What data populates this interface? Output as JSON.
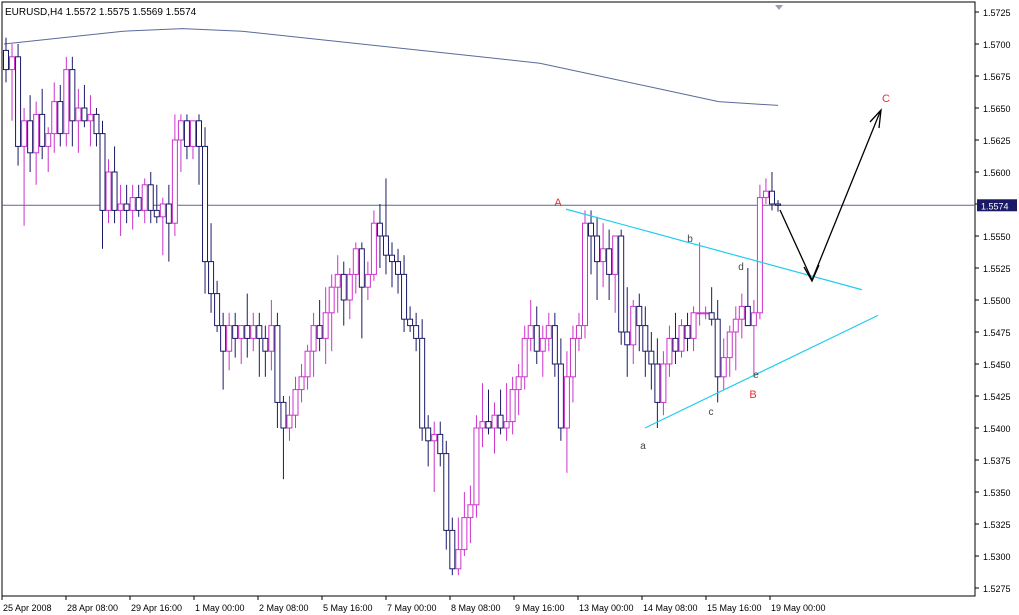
{
  "header": {
    "symbol_line": "EURUSD,H4  1.5572 1.5575 1.5569 1.5574"
  },
  "colors": {
    "background": "#ffffff",
    "bull": "#cc33cc",
    "bear": "#1a1a66",
    "moving_average": "#5a6a9a",
    "triangle": "#22ccee",
    "wave_labels_red": "#e83030",
    "wave_labels_gray": "#444444",
    "arrows": "#000000",
    "price_line": "#5a6a8a",
    "price_box": "#1a1a66"
  },
  "chart_data": {
    "type": "candlestick",
    "title": "EURUSD,H4",
    "header_values": {
      "open": 1.5572,
      "high": 1.5575,
      "low": 1.5569,
      "close": 1.5574
    },
    "x_tick_labels": [
      "25 Apr 2008",
      "28 Apr 08:00",
      "29 Apr 16:00",
      "1 May 00:00",
      "2 May 08:00",
      "5 May 16:00",
      "7 May 00:00",
      "8 May 08:00",
      "9 May 16:00",
      "13 May 00:00",
      "14 May 08:00",
      "15 May 16:00",
      "19 May 00:00"
    ],
    "y_tick_labels": [
      "1.5725",
      "1.5700",
      "1.5675",
      "1.5650",
      "1.5625",
      "1.5600",
      "1.5575",
      "1.5550",
      "1.5525",
      "1.5500",
      "1.5475",
      "1.5450",
      "1.5425",
      "1.5400",
      "1.5375",
      "1.5350",
      "1.5325",
      "1.5300",
      "1.5275"
    ],
    "ylim": [
      1.5268,
      1.5729
    ],
    "current_price": "1.5574",
    "candles": [
      [
        1.5695,
        1.5705,
        1.567,
        1.568
      ],
      [
        1.568,
        1.57,
        1.564,
        1.569
      ],
      [
        1.569,
        1.57,
        1.5605,
        1.562
      ],
      [
        1.562,
        1.565,
        1.5558,
        1.564
      ],
      [
        1.564,
        1.566,
        1.56,
        1.5615
      ],
      [
        1.5615,
        1.5655,
        1.559,
        1.5645
      ],
      [
        1.5645,
        1.5665,
        1.561,
        1.562
      ],
      [
        1.562,
        1.5635,
        1.56,
        1.563
      ],
      [
        1.563,
        1.567,
        1.5615,
        1.5655
      ],
      [
        1.5655,
        1.5668,
        1.562,
        1.563
      ],
      [
        1.563,
        1.569,
        1.562,
        1.568
      ],
      [
        1.568,
        1.569,
        1.562,
        1.564
      ],
      [
        1.564,
        1.5665,
        1.5615,
        1.565
      ],
      [
        1.565,
        1.5668,
        1.5635,
        1.564
      ],
      [
        1.564,
        1.566,
        1.562,
        1.5645
      ],
      [
        1.5645,
        1.565,
        1.562,
        1.563
      ],
      [
        1.563,
        1.564,
        1.554,
        1.557
      ],
      [
        1.557,
        1.561,
        1.556,
        1.56
      ],
      [
        1.56,
        1.562,
        1.556,
        1.557
      ],
      [
        1.557,
        1.559,
        1.555,
        1.5575
      ],
      [
        1.5575,
        1.559,
        1.556,
        1.557
      ],
      [
        1.557,
        1.559,
        1.5555,
        1.558
      ],
      [
        1.558,
        1.559,
        1.5565,
        1.557
      ],
      [
        1.557,
        1.5595,
        1.556,
        1.559
      ],
      [
        1.559,
        1.56,
        1.556,
        1.557
      ],
      [
        1.557,
        1.559,
        1.556,
        1.5565
      ],
      [
        1.5565,
        1.558,
        1.5535,
        1.5575
      ],
      [
        1.5575,
        1.559,
        1.553,
        1.556
      ],
      [
        1.556,
        1.5645,
        1.555,
        1.5625
      ],
      [
        1.5625,
        1.5645,
        1.56,
        1.564
      ],
      [
        1.564,
        1.5645,
        1.561,
        1.562
      ],
      [
        1.562,
        1.564,
        1.561,
        1.564
      ],
      [
        1.564,
        1.5645,
        1.559,
        1.562
      ],
      [
        1.562,
        1.5635,
        1.5505,
        1.553
      ],
      [
        1.553,
        1.556,
        1.549,
        1.5505
      ],
      [
        1.5505,
        1.5515,
        1.5475,
        1.548
      ],
      [
        1.548,
        1.549,
        1.543,
        1.546
      ],
      [
        1.546,
        1.549,
        1.5445,
        1.548
      ],
      [
        1.548,
        1.549,
        1.5455,
        1.547
      ],
      [
        1.547,
        1.548,
        1.545,
        1.548
      ],
      [
        1.548,
        1.5505,
        1.5455,
        1.547
      ],
      [
        1.547,
        1.549,
        1.546,
        1.548
      ],
      [
        1.548,
        1.549,
        1.544,
        1.547
      ],
      [
        1.547,
        1.548,
        1.544,
        1.546
      ],
      [
        1.546,
        1.55,
        1.5445,
        1.548
      ],
      [
        1.548,
        1.549,
        1.54,
        1.542
      ],
      [
        1.542,
        1.5425,
        1.536,
        1.54
      ],
      [
        1.54,
        1.5425,
        1.539,
        1.541
      ],
      [
        1.541,
        1.544,
        1.54,
        1.543
      ],
      [
        1.543,
        1.545,
        1.542,
        1.544
      ],
      [
        1.544,
        1.5465,
        1.543,
        1.546
      ],
      [
        1.546,
        1.549,
        1.544,
        1.548
      ],
      [
        1.548,
        1.55,
        1.546,
        1.547
      ],
      [
        1.547,
        1.551,
        1.545,
        1.549
      ],
      [
        1.549,
        1.552,
        1.546,
        1.551
      ],
      [
        1.551,
        1.5535,
        1.549,
        1.552
      ],
      [
        1.552,
        1.553,
        1.548,
        1.55
      ],
      [
        1.55,
        1.5525,
        1.5485,
        1.552
      ],
      [
        1.552,
        1.5545,
        1.5505,
        1.554
      ],
      [
        1.554,
        1.5545,
        1.547,
        1.551
      ],
      [
        1.551,
        1.553,
        1.55,
        1.552
      ],
      [
        1.552,
        1.557,
        1.5515,
        1.556
      ],
      [
        1.556,
        1.5575,
        1.5525,
        1.555
      ],
      [
        1.555,
        1.5595,
        1.552,
        1.5535
      ],
      [
        1.5535,
        1.5545,
        1.551,
        1.553
      ],
      [
        1.553,
        1.554,
        1.5505,
        1.552
      ],
      [
        1.552,
        1.5535,
        1.5475,
        1.5485
      ],
      [
        1.5485,
        1.5495,
        1.5475,
        1.548
      ],
      [
        1.548,
        1.549,
        1.546,
        1.547
      ],
      [
        1.547,
        1.5485,
        1.539,
        1.54
      ],
      [
        1.54,
        1.541,
        1.537,
        1.539
      ],
      [
        1.539,
        1.5405,
        1.535,
        1.5395
      ],
      [
        1.5395,
        1.5405,
        1.537,
        1.538
      ],
      [
        1.538,
        1.539,
        1.5305,
        1.532
      ],
      [
        1.532,
        1.533,
        1.5285,
        1.529
      ],
      [
        1.529,
        1.533,
        1.5285,
        1.5305
      ],
      [
        1.5305,
        1.535,
        1.53,
        1.533
      ],
      [
        1.533,
        1.5355,
        1.531,
        1.534
      ],
      [
        1.534,
        1.541,
        1.533,
        1.54
      ],
      [
        1.54,
        1.5435,
        1.5385,
        1.5405
      ],
      [
        1.5405,
        1.543,
        1.5395,
        1.54
      ],
      [
        1.54,
        1.542,
        1.538,
        1.541
      ],
      [
        1.541,
        1.543,
        1.5395,
        1.54
      ],
      [
        1.54,
        1.5435,
        1.539,
        1.5405
      ],
      [
        1.5405,
        1.544,
        1.5395,
        1.543
      ],
      [
        1.543,
        1.545,
        1.541,
        1.544
      ],
      [
        1.544,
        1.548,
        1.543,
        1.547
      ],
      [
        1.547,
        1.55,
        1.546,
        1.548
      ],
      [
        1.548,
        1.5495,
        1.545,
        1.546
      ],
      [
        1.546,
        1.548,
        1.544,
        1.547
      ],
      [
        1.547,
        1.549,
        1.546,
        1.548
      ],
      [
        1.548,
        1.549,
        1.544,
        1.545
      ],
      [
        1.545,
        1.547,
        1.539,
        1.54
      ],
      [
        1.54,
        1.546,
        1.5365,
        1.544
      ],
      [
        1.544,
        1.548,
        1.542,
        1.547
      ],
      [
        1.547,
        1.549,
        1.546,
        1.548
      ],
      [
        1.548,
        1.557,
        1.547,
        1.556
      ],
      [
        1.556,
        1.557,
        1.552,
        1.555
      ],
      [
        1.555,
        1.5565,
        1.55,
        1.553
      ],
      [
        1.553,
        1.556,
        1.551,
        1.554
      ],
      [
        1.554,
        1.5555,
        1.55,
        1.552
      ],
      [
        1.552,
        1.5545,
        1.549,
        1.555
      ],
      [
        1.555,
        1.5555,
        1.5465,
        1.5475
      ],
      [
        1.5475,
        1.551,
        1.544,
        1.5465
      ],
      [
        1.5465,
        1.55,
        1.545,
        1.5495
      ],
      [
        1.5495,
        1.5505,
        1.546,
        1.548
      ],
      [
        1.548,
        1.5495,
        1.544,
        1.546
      ],
      [
        1.546,
        1.5475,
        1.543,
        1.545
      ],
      [
        1.545,
        1.547,
        1.54,
        1.542
      ],
      [
        1.542,
        1.546,
        1.541,
        1.545
      ],
      [
        1.545,
        1.548,
        1.544,
        1.547
      ],
      [
        1.547,
        1.549,
        1.545,
        1.546
      ],
      [
        1.546,
        1.5485,
        1.5455,
        1.548
      ],
      [
        1.548,
        1.549,
        1.546,
        1.547
      ],
      [
        1.547,
        1.5495,
        1.546,
        1.549
      ],
      [
        1.549,
        1.5545,
        1.548,
        1.549
      ],
      [
        1.549,
        1.5495,
        1.5485,
        1.549
      ],
      [
        1.549,
        1.551,
        1.548,
        1.5485
      ],
      [
        1.5485,
        1.55,
        1.542,
        1.544
      ],
      [
        1.544,
        1.547,
        1.543,
        1.5455
      ],
      [
        1.5455,
        1.548,
        1.544,
        1.5475
      ],
      [
        1.5475,
        1.5495,
        1.5445,
        1.5485
      ],
      [
        1.5485,
        1.5505,
        1.547,
        1.5495
      ],
      [
        1.5495,
        1.5525,
        1.548,
        1.548
      ],
      [
        1.548,
        1.55,
        1.544,
        1.549
      ],
      [
        1.549,
        1.559,
        1.5485,
        1.558
      ],
      [
        1.558,
        1.5595,
        1.5575,
        1.5585
      ],
      [
        1.5585,
        1.56,
        1.557,
        1.5575
      ],
      [
        1.5575,
        1.5578,
        1.5569,
        1.5574
      ]
    ],
    "moving_average": [
      1.57,
      1.5705,
      1.571,
      1.5712,
      1.571,
      1.5705,
      1.57,
      1.5695,
      1.569,
      1.5685,
      1.5675,
      1.5665,
      1.5655,
      1.5652
    ],
    "triangle_upper": [
      [
        1.5571,
        1.5523
      ],
      [
        1.552,
        1.5508
      ]
    ],
    "triangle_lower": [
      [
        1.54,
        1.5435
      ],
      [
        1.5435,
        1.5488
      ]
    ],
    "wave_labels": [
      {
        "label": "A",
        "price": 1.5575,
        "color": "red"
      },
      {
        "label": "B",
        "price": 1.5432,
        "color": "red"
      },
      {
        "label": "C",
        "price": 1.5665,
        "color": "red"
      },
      {
        "label": "a",
        "price": 1.5385,
        "color": "gray"
      },
      {
        "label": "b",
        "price": 1.5548,
        "color": "gray"
      },
      {
        "label": "c",
        "price": 1.5418,
        "color": "gray"
      },
      {
        "label": "d",
        "price": 1.5528,
        "color": "gray"
      },
      {
        "label": "e",
        "price": 1.5446,
        "color": "gray"
      }
    ]
  }
}
